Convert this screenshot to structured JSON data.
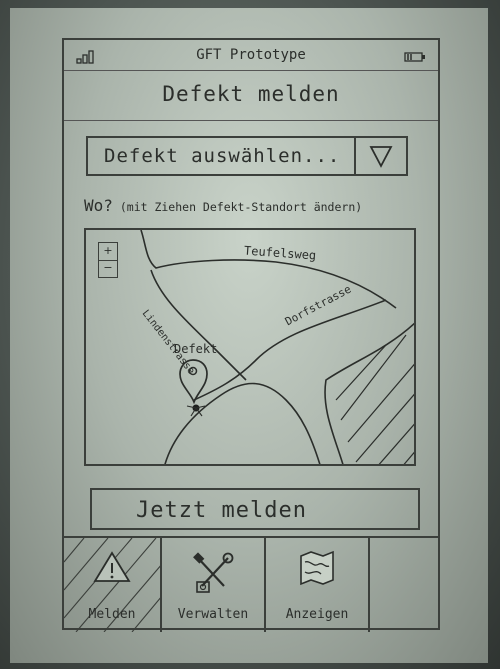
{
  "app": {
    "title": "GFT Prototype"
  },
  "status_bar": {
    "signal_icon": "signal-icon",
    "battery_icon": "battery-icon"
  },
  "header": {
    "title": "Defekt melden"
  },
  "defect_select": {
    "value": "Defekt auswählen...",
    "icon": "triangle-down-icon"
  },
  "location_hint": {
    "lead": "Wo?",
    "detail": "(mit Ziehen Defekt-Standort ändern)"
  },
  "map": {
    "zoom_in": "+",
    "zoom_out": "−",
    "streets": [
      "Teufelsweg",
      "Lindenstrasse",
      "Dorfstrasse"
    ],
    "marker_label": "Defekt",
    "marker_icon": "map-pin-icon"
  },
  "submit": {
    "label": "Jetzt melden"
  },
  "tabs": [
    {
      "label": "Melden",
      "icon": "warning-triangle-icon",
      "selected": true
    },
    {
      "label": "Verwalten",
      "icon": "tools-icon",
      "selected": false
    },
    {
      "label": "Anzeigen",
      "icon": "map-icon",
      "selected": false
    },
    {
      "label": "",
      "icon": "",
      "selected": false
    }
  ]
}
